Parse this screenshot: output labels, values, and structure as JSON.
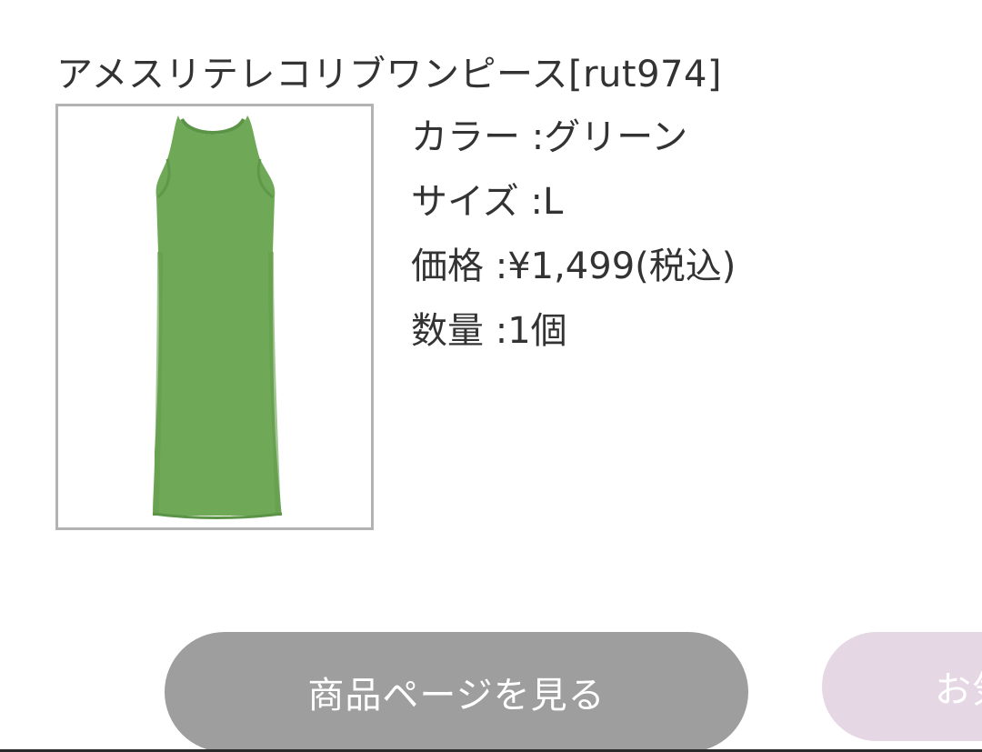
{
  "product": {
    "title": "アメスリテレコリブワンピース[rut974]",
    "image_alt": "green-ribbed-tank-dress",
    "color_line": "カラー :グリーン",
    "size_line": "サイズ :L",
    "price_line": "価格 :¥1,499(税込)",
    "quantity_line": "数量 :1個"
  },
  "actions": {
    "view_product_label": "商品ページを見る",
    "secondary_label_partial": "お気"
  },
  "colors": {
    "view_button_bg": "#9e9e9e",
    "secondary_button_bg": "#e6d7e4",
    "dress_green": "#6fa957",
    "image_border": "#b3b3b3"
  }
}
